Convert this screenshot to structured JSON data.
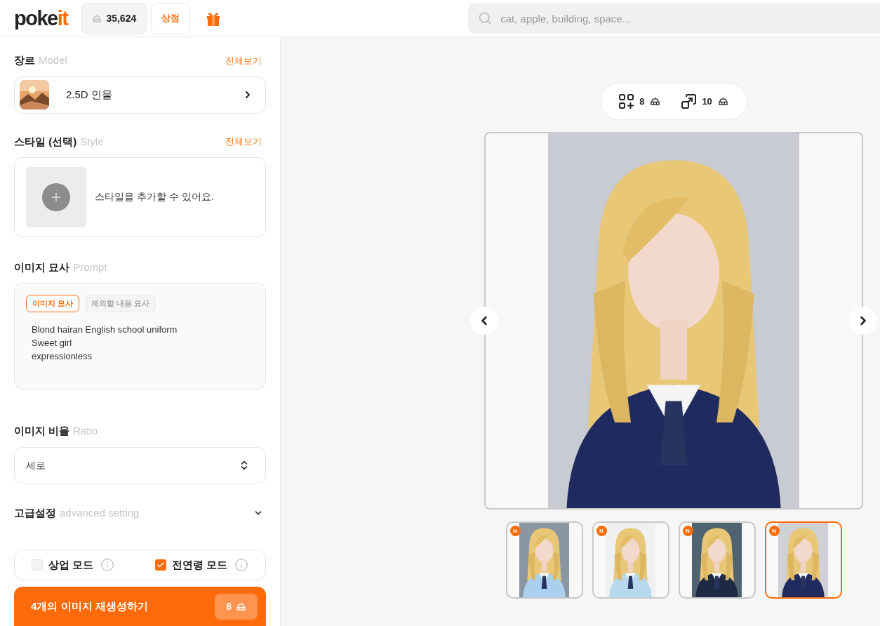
{
  "header": {
    "logo": [
      {
        "text": "poke",
        "kind": "plain"
      },
      {
        "text": "it",
        "kind": "accent"
      }
    ],
    "credits": "35,624",
    "shop": "상점",
    "search": {
      "placeholder": "cat, apple, building, space..."
    }
  },
  "model": {
    "title": "장르",
    "subtitle": "Model",
    "link": "전체보기",
    "value": "2.5D 인물"
  },
  "style": {
    "title": "스타일 (선택)",
    "subtitle": "Style",
    "link": "전체보기",
    "empty_text": "스타일을 추가할 수 있어요."
  },
  "prompt": {
    "title": "이미지 묘사",
    "subtitle": "Prompt",
    "tabs": [
      {
        "label": "이미지 묘사",
        "selected": true
      },
      {
        "label": "제외할 내용 묘사",
        "selected": false
      }
    ],
    "text": "Blond hairan English school uniform\nSweet girl\nexpressionless"
  },
  "ratio": {
    "title": "이미지 비율",
    "subtitle": "Ratio",
    "value": "세로"
  },
  "advanced": {
    "title": "고급설정",
    "subtitle": "advanced setting",
    "expanded": false
  },
  "modes": [
    {
      "label": "상업 모드",
      "checked": false
    },
    {
      "label": "전연령 모드",
      "checked": true
    }
  ],
  "generate": {
    "label": "4개의 이미지 재생성하기",
    "cost": "8"
  },
  "costs": [
    {
      "kind": "add",
      "amount": "8"
    },
    {
      "kind": "upscale",
      "amount": "10"
    }
  ],
  "thumbnails": [
    {
      "badge": "N",
      "selected": false
    },
    {
      "badge": "N",
      "selected": false
    },
    {
      "badge": "N",
      "selected": false
    },
    {
      "badge": "N",
      "selected": true
    }
  ]
}
